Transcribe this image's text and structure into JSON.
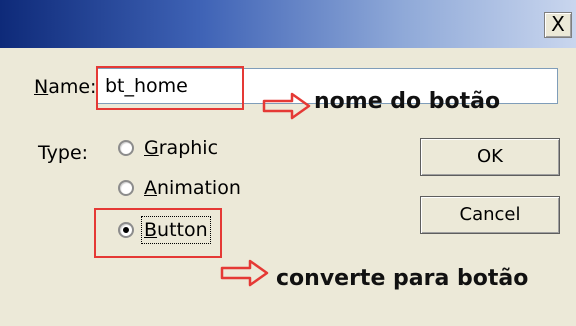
{
  "dialog": {
    "close_glyph": "X",
    "name_label": {
      "prefix": "N",
      "rest": "ame:"
    },
    "name_value": "bt_home",
    "type_label": "Type:",
    "radio_options": [
      {
        "accel": "G",
        "rest": "raphic",
        "checked": false
      },
      {
        "accel": "A",
        "rest": "nimation",
        "checked": false
      },
      {
        "accel": "B",
        "rest": "utton",
        "checked": true
      }
    ],
    "ok_label": "OK",
    "cancel_label": "Cancel"
  },
  "annotations": {
    "arrow_icon": "outline-right-arrow-icon",
    "highlight_color": "#e53935",
    "name_note": "nome do botão",
    "button_note": "converte para botão"
  }
}
